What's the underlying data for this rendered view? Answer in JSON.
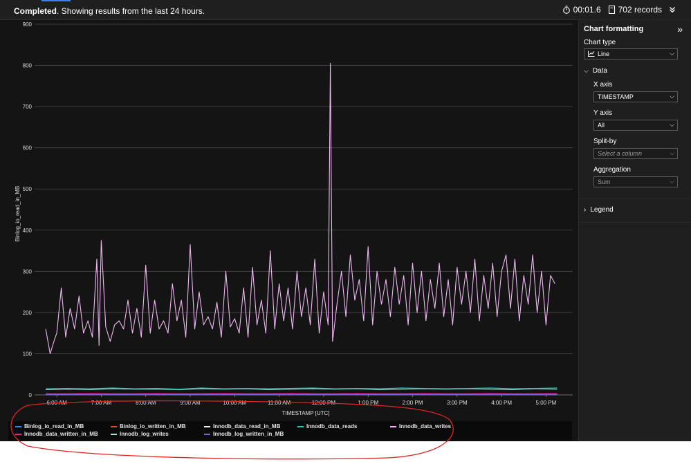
{
  "status": {
    "bold": "Completed",
    "text": ". Showing results from the last 24 hours."
  },
  "stats": {
    "duration": "00:01.6",
    "records": "702 records"
  },
  "side": {
    "title": "Chart formatting",
    "chart_type_label": "Chart type",
    "chart_type_value": "Line",
    "data_section": "Data",
    "x_axis_label": "X axis",
    "x_axis_value": "TIMESTAMP",
    "y_axis_label": "Y axis",
    "y_axis_value": "All",
    "split_label": "Split-by",
    "split_placeholder": "Select a column",
    "agg_label": "Aggregation",
    "agg_value": "Sum",
    "legend_section": "Legend"
  },
  "colors": {
    "Binlog_io_read_in_MB": "#1f8ee6",
    "Binlog_io_written_in_MB": "#e8403a",
    "Innodb_data_read_in_MB": "#f0f0f0",
    "Innodb_data_reads": "#2ec4b6",
    "Innodb_data_writes": "#f1b8f4",
    "Innodb_data_written_in_MB": "#e0288a",
    "Innodb_log_writes": "#a8e6c8",
    "Innodb_log_written_in_MB": "#7a66e0"
  },
  "chart_data": {
    "type": "line",
    "xlabel": "TIMESTAMP [UTC]",
    "ylabel": "Binlog_io_read_in_MB",
    "ylim": [
      0,
      900
    ],
    "yticks": [
      "0",
      "100",
      "200",
      "300",
      "400",
      "500",
      "600",
      "700",
      "800",
      "900"
    ],
    "xticks": [
      "6:00 AM",
      "7:00 AM",
      "8:00 AM",
      "9:00 AM",
      "10:00 AM",
      "11:00 AM",
      "12:00 PM",
      "1:00 PM",
      "2:00 PM",
      "3:00 PM",
      "4:00 PM",
      "5:00 PM"
    ],
    "grid": true,
    "legend_position": "bottom",
    "series_order": [
      "Binlog_io_read_in_MB",
      "Binlog_io_written_in_MB",
      "Innodb_data_read_in_MB",
      "Innodb_data_reads",
      "Innodb_data_writes",
      "Innodb_data_written_in_MB",
      "Innodb_log_writes",
      "Innodb_log_written_in_MB"
    ],
    "series": [
      {
        "name": "Innodb_data_writes",
        "x_hours": [
          5.75,
          5.85,
          5.95,
          6.0,
          6.1,
          6.2,
          6.3,
          6.4,
          6.5,
          6.6,
          6.7,
          6.8,
          6.9,
          6.95,
          7.0,
          7.1,
          7.2,
          7.3,
          7.4,
          7.5,
          7.6,
          7.7,
          7.8,
          7.9,
          8.0,
          8.1,
          8.2,
          8.3,
          8.4,
          8.5,
          8.6,
          8.7,
          8.8,
          8.9,
          9.0,
          9.1,
          9.2,
          9.3,
          9.4,
          9.5,
          9.6,
          9.7,
          9.8,
          9.9,
          10.0,
          10.1,
          10.2,
          10.3,
          10.4,
          10.5,
          10.6,
          10.7,
          10.8,
          10.9,
          11.0,
          11.1,
          11.2,
          11.3,
          11.4,
          11.5,
          11.6,
          11.7,
          11.8,
          11.9,
          12.0,
          12.1,
          12.15,
          12.2,
          12.3,
          12.4,
          12.5,
          12.6,
          12.7,
          12.8,
          12.9,
          13.0,
          13.1,
          13.2,
          13.3,
          13.4,
          13.5,
          13.6,
          13.7,
          13.8,
          13.9,
          14.0,
          14.1,
          14.2,
          14.3,
          14.4,
          14.5,
          14.6,
          14.7,
          14.8,
          14.9,
          15.0,
          15.1,
          15.2,
          15.3,
          15.4,
          15.5,
          15.6,
          15.7,
          15.8,
          15.9,
          16.0,
          16.1,
          16.2,
          16.3,
          16.4,
          16.5,
          16.6,
          16.7,
          16.8,
          16.9,
          17.0,
          17.1,
          17.2
        ],
        "values": [
          160,
          100,
          135,
          150,
          260,
          140,
          210,
          160,
          240,
          150,
          180,
          140,
          330,
          120,
          375,
          165,
          130,
          170,
          180,
          160,
          230,
          150,
          210,
          140,
          315,
          150,
          230,
          160,
          180,
          150,
          270,
          180,
          230,
          140,
          365,
          160,
          250,
          170,
          190,
          160,
          225,
          140,
          300,
          165,
          185,
          150,
          260,
          140,
          310,
          170,
          230,
          150,
          350,
          160,
          270,
          180,
          260,
          160,
          300,
          190,
          260,
          170,
          330,
          150,
          250,
          170,
          805,
          130,
          220,
          300,
          190,
          340,
          230,
          280,
          180,
          360,
          170,
          300,
          220,
          280,
          190,
          310,
          220,
          290,
          170,
          320,
          200,
          300,
          180,
          280,
          210,
          320,
          190,
          280,
          170,
          310,
          220,
          300,
          200,
          330,
          180,
          290,
          210,
          320,
          190,
          300,
          340,
          210,
          330,
          180,
          290,
          220,
          340,
          200,
          300,
          170,
          290,
          270
        ]
      },
      {
        "name": "Innodb_data_reads",
        "x_hours": [
          5.75,
          6.25,
          6.75,
          7.25,
          7.75,
          8.25,
          8.75,
          9.25,
          9.75,
          10.25,
          10.75,
          11.25,
          11.75,
          12.25,
          12.75,
          13.25,
          13.75,
          14.25,
          14.75,
          15.25,
          15.75,
          16.25,
          16.75,
          17.25
        ],
        "values": [
          15,
          16,
          15,
          17,
          15,
          16,
          14,
          17,
          15,
          16,
          15,
          16,
          17,
          15,
          16,
          15,
          17,
          16,
          15,
          16,
          17,
          15,
          16,
          17
        ]
      },
      {
        "name": "Innodb_log_writes",
        "x_hours": [
          5.75,
          6.25,
          6.75,
          7.25,
          7.75,
          8.25,
          8.75,
          9.25,
          9.75,
          10.25,
          10.75,
          11.25,
          11.75,
          12.25,
          12.75,
          13.25,
          13.75,
          14.25,
          14.75,
          15.25,
          15.75,
          16.25,
          16.75,
          17.25
        ],
        "values": [
          13,
          14,
          13,
          15,
          14,
          14,
          13,
          15,
          14,
          15,
          13,
          14,
          15,
          14,
          15,
          13,
          14,
          15,
          14,
          15,
          14,
          13,
          15,
          14
        ]
      },
      {
        "name": "Innodb_data_written_in_MB",
        "x_hours": [
          5.75,
          6.25,
          6.75,
          7.25,
          7.75,
          8.25,
          8.75,
          9.25,
          9.75,
          10.25,
          10.75,
          11.25,
          11.75,
          12.25,
          12.75,
          13.25,
          13.75,
          14.25,
          14.75,
          15.25,
          15.75,
          16.25,
          16.75,
          17.25
        ],
        "values": [
          3,
          3,
          4,
          3,
          3,
          4,
          3,
          3,
          4,
          3,
          3,
          4,
          3,
          3,
          4,
          3,
          3,
          4,
          3,
          3,
          4,
          3,
          3,
          4
        ]
      },
      {
        "name": "Innodb_log_written_in_MB",
        "x_hours": [
          5.75,
          17.25
        ],
        "values": [
          1,
          1
        ]
      },
      {
        "name": "Binlog_io_written_in_MB",
        "x_hours": [
          5.75,
          17.25
        ],
        "values": [
          1,
          1
        ]
      },
      {
        "name": "Binlog_io_read_in_MB",
        "x_hours": [
          5.75,
          17.25
        ],
        "values": [
          0,
          0
        ]
      },
      {
        "name": "Innodb_data_read_in_MB",
        "x_hours": [
          5.75,
          17.25
        ],
        "values": [
          0,
          0
        ]
      }
    ],
    "annotation_color": "#e32222"
  }
}
